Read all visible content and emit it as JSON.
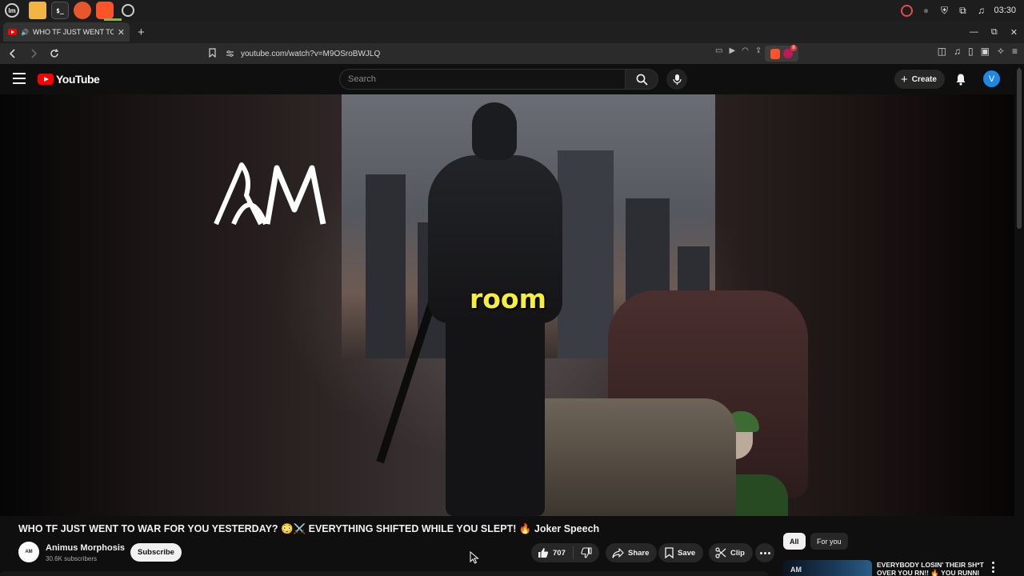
{
  "os_panel": {
    "launchers": [
      "linux-mint-menu-icon",
      "files-icon",
      "terminal-icon",
      "firefox-icon",
      "brave-icon",
      "chrome-icon"
    ],
    "clock": "03:30"
  },
  "browser": {
    "tab": {
      "title": "WHO TF JUST WENT TO W",
      "close": "✕"
    },
    "new_tab": "+",
    "window_controls": {
      "minimize": "—",
      "maximize": "⧉",
      "close": "✕"
    },
    "url": "youtube.com/watch?v=M9OSroBWJLQ"
  },
  "youtube": {
    "logo_text": "YouTube",
    "search_placeholder": "Search",
    "create_label": "Create",
    "avatar_letter": "V"
  },
  "player": {
    "caption": "room",
    "watermark_text": "AM"
  },
  "video": {
    "title": "WHO TF JUST WENT TO WAR FOR YOU YESTERDAY? 😳⚔️ EVERYTHING SHIFTED WHILE YOU SLEPT! 🔥 Joker Speech",
    "channel_name": "Animus Morphosis",
    "channel_avatar_text": "AM",
    "subscribers": "30.6K subscribers",
    "subscribe_label": "Subscribe",
    "likes": "707",
    "share_label": "Share",
    "save_label": "Save",
    "clip_label": "Clip"
  },
  "sidebar": {
    "chips": [
      "All",
      "For you"
    ],
    "recommendation": {
      "title": "EVERYBODY LOSIN' THEIR SH*T OVER YOU RN!! 🔥 YOU RUNNI",
      "thumb_logo": "AM"
    }
  },
  "colors": {
    "youtube_red": "#ff0000",
    "caption_yellow": "#f5ee3a",
    "avatar_blue": "#1e88e5",
    "background": "#0f0f0f"
  }
}
